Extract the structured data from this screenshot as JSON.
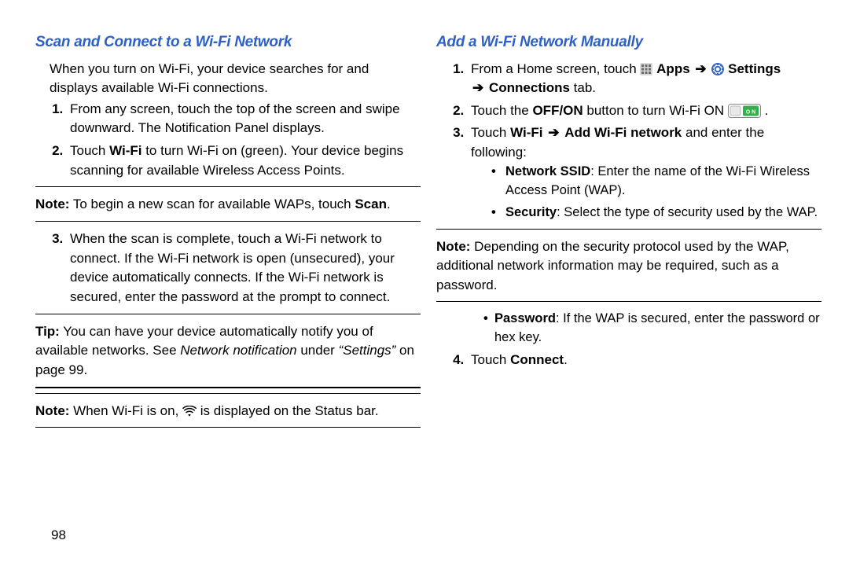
{
  "page_number": "98",
  "left": {
    "heading": "Scan and Connect to a Wi-Fi Network",
    "intro": "When you turn on Wi-Fi, your device searches for and displays available Wi-Fi connections.",
    "step1": "From any screen, touch the top of the screen and swipe downward. The Notification Panel displays.",
    "step2_a": "Touch ",
    "step2_wifi": "Wi-Fi",
    "step2_b": " to turn Wi-Fi on (green). Your device begins scanning for available Wireless Access Points.",
    "note1_label": "Note:",
    "note1_a": " To begin a new scan for available WAPs, touch ",
    "note1_scan": "Scan",
    "note1_b": ".",
    "step3": "When the scan is complete, touch a Wi-Fi network to connect. If the Wi-Fi network is open (unsecured), your device automatically connects. If the Wi-Fi network is secured, enter the password at the prompt to connect.",
    "tip_label": "Tip:",
    "tip_a": " You can have your device automatically notify you of available networks. See ",
    "tip_i": "Network notification",
    "tip_b": " under ",
    "tip_ref": "“Settings”",
    "tip_c": " on page 99.",
    "note2_label": "Note:",
    "note2_a": " When Wi-Fi is on, ",
    "note2_b": " is displayed on the Status bar."
  },
  "right": {
    "heading": "Add a Wi-Fi Network Manually",
    "step1_a": "From a Home screen, touch ",
    "step1_apps": "Apps",
    "step1_settings": "Settings",
    "step1_conn": "Connections",
    "step1_tab": " tab.",
    "step2_a": "Touch the ",
    "step2_offon": "OFF/ON",
    "step2_b": " button to turn Wi-Fi ON  ",
    "step2_c": ".",
    "step3_a": "Touch ",
    "step3_wifi": "Wi-Fi",
    "step3_add": "Add Wi-Fi network",
    "step3_b": " and enter the following:",
    "b1_label": "Network SSID",
    "b1_txt": ": Enter the name of the Wi-Fi Wireless Access Point (WAP).",
    "b2_label": "Security",
    "b2_txt": ": Select the type of security used by the WAP.",
    "note_label": "Note:",
    "note_txt": " Depending on the security protocol used by the WAP, additional network information may be required, such as a password.",
    "b3_label": "Password",
    "b3_txt": ": If the WAP is secured, enter the password or hex key.",
    "step4_a": "Touch ",
    "step4_conn": "Connect",
    "step4_b": "."
  }
}
